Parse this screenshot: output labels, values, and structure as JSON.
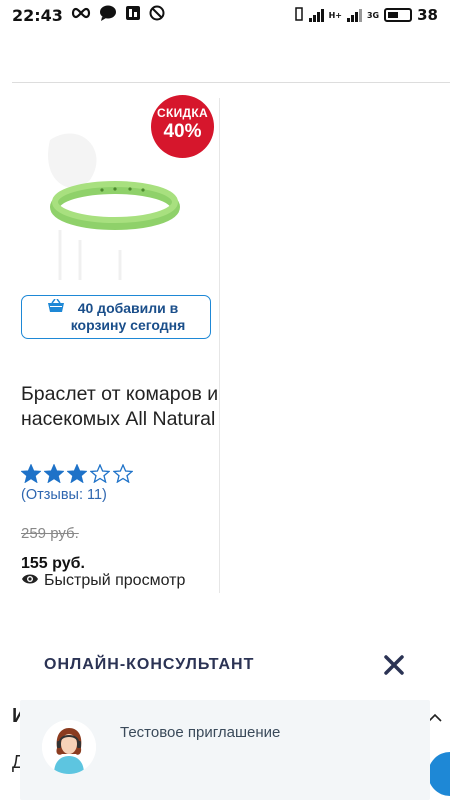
{
  "status_bar": {
    "time": "22:43",
    "net_hplus": "H+",
    "net_3g": "3G",
    "battery": "38"
  },
  "product": {
    "discount_label": "СКИДКА",
    "discount_value": "40%",
    "cart_text_line1": "40 добавили в",
    "cart_text_line2": "корзину сегодня",
    "title": "Браслет от комаров и насекомых All Natural",
    "rating": 3,
    "rating_max": 5,
    "reviews": "(Отзывы: 11)",
    "old_price": "259 руб.",
    "price": "155 руб.",
    "quick_view": "Быстрый просмотр"
  },
  "consultant": {
    "title": "ОНЛАЙН-КОНСУЛЬТАНТ",
    "invite": "Тестовое приглашение",
    "behind_heading": "И",
    "behind_text": "Д"
  },
  "colors": {
    "accent_blue": "#1e88d6",
    "discount_red": "#d6162c",
    "star_blue": "#1e72c8",
    "consult_dark": "#2b3354"
  }
}
